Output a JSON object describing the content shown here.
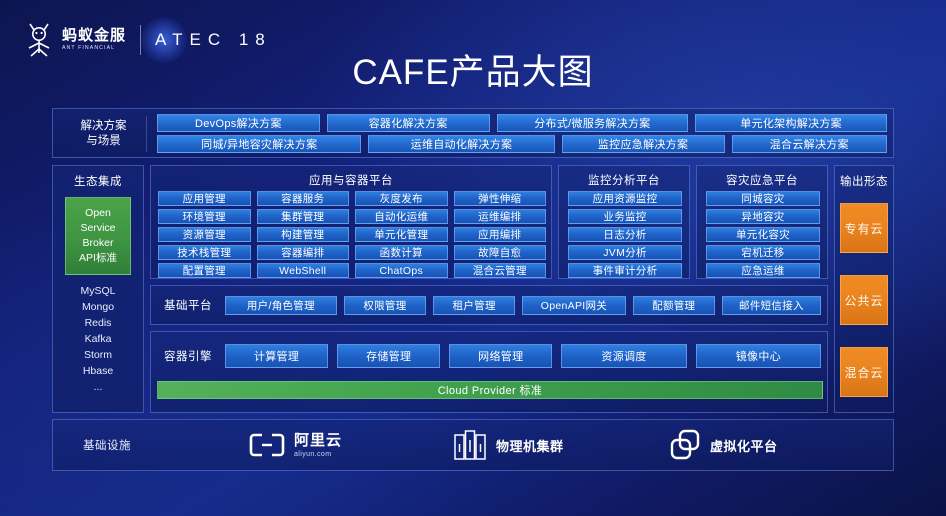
{
  "header": {
    "brand_cn": "蚂蚁金服",
    "brand_en": "ANT FINANCIAL",
    "event": "ATEC 18",
    "title": "CAFE产品大图"
  },
  "solutions": {
    "label_line1": "解决方案",
    "label_line2": "与场景",
    "row1": [
      {
        "label": "DevOps解决方案",
        "flex": 1.0
      },
      {
        "label": "容器化解决方案",
        "flex": 1.0
      },
      {
        "label": "分布式/微服务解决方案",
        "flex": 1.18
      },
      {
        "label": "单元化架构解决方案",
        "flex": 1.18
      }
    ],
    "row2": [
      {
        "label": "同城/异地容灾解决方案",
        "flex": 1.32
      },
      {
        "label": "运维自动化解决方案",
        "flex": 1.2
      },
      {
        "label": "监控应急解决方案",
        "flex": 1.05
      },
      {
        "label": "混合云解决方案",
        "flex": 1.0
      }
    ]
  },
  "ecosystem": {
    "title": "生态集成",
    "standard_lines": [
      "Open",
      "Service",
      "Broker",
      "API标准"
    ],
    "items": [
      "MySQL",
      "Mongo",
      "Redis",
      "Kafka",
      "Storm",
      "Hbase",
      "..."
    ]
  },
  "app_platform": {
    "title": "应用与容器平台",
    "cells": [
      "应用管理",
      "容器服务",
      "灰度发布",
      "弹性伸缩",
      "环境管理",
      "集群管理",
      "自动化运维",
      "运维编排",
      "资源管理",
      "构建管理",
      "单元化管理",
      "应用编排",
      "技术栈管理",
      "容器编排",
      "函数计算",
      "故障自愈",
      "配置管理",
      "WebShell",
      "ChatOps",
      "混合云管理"
    ]
  },
  "monitor_platform": {
    "title": "监控分析平台",
    "items": [
      "应用资源监控",
      "业务监控",
      "日志分析",
      "JVM分析",
      "事件审计分析"
    ]
  },
  "dr_platform": {
    "title": "容灾应急平台",
    "items": [
      "同城容灾",
      "异地容灾",
      "单元化容灾",
      "宕机迁移",
      "应急运维"
    ]
  },
  "output": {
    "title": "输出形态",
    "items": [
      "专有云",
      "公共云",
      "混合云"
    ]
  },
  "base_platform": {
    "label": "基础平台",
    "items": [
      {
        "label": "用户/角色管理",
        "flex": 1.3
      },
      {
        "label": "权限管理",
        "flex": 0.95
      },
      {
        "label": "租户管理",
        "flex": 0.95
      },
      {
        "label": "OpenAPI网关",
        "flex": 1.2
      },
      {
        "label": "配额管理",
        "flex": 0.95
      },
      {
        "label": "邮件短信接入",
        "flex": 1.15
      }
    ]
  },
  "container_engine": {
    "label": "容器引擎",
    "items": [
      {
        "label": "计算管理",
        "flex": 1.0
      },
      {
        "label": "存储管理",
        "flex": 1.0
      },
      {
        "label": "网络管理",
        "flex": 1.0
      },
      {
        "label": "资源调度",
        "flex": 1.22
      },
      {
        "label": "镜像中心",
        "flex": 1.22
      }
    ],
    "cloud_provider_bar": "Cloud Provider 标准"
  },
  "infrastructure": {
    "label": "基础设施",
    "items": [
      {
        "name_cn": "阿里云",
        "name_en": "aliyun.com",
        "icon": "aliyun-icon"
      },
      {
        "name_cn": "物理机集群",
        "icon": "server-rack-icon"
      },
      {
        "name_cn": "虚拟化平台",
        "icon": "virtualization-icon"
      }
    ]
  },
  "colors": {
    "background_deep": "#0d1550",
    "background_mid": "#14298c",
    "chip_blue": "#2167cc",
    "accent_green": "#3f9542",
    "accent_orange": "#e8821e",
    "panel_border": "#78a0ff"
  }
}
